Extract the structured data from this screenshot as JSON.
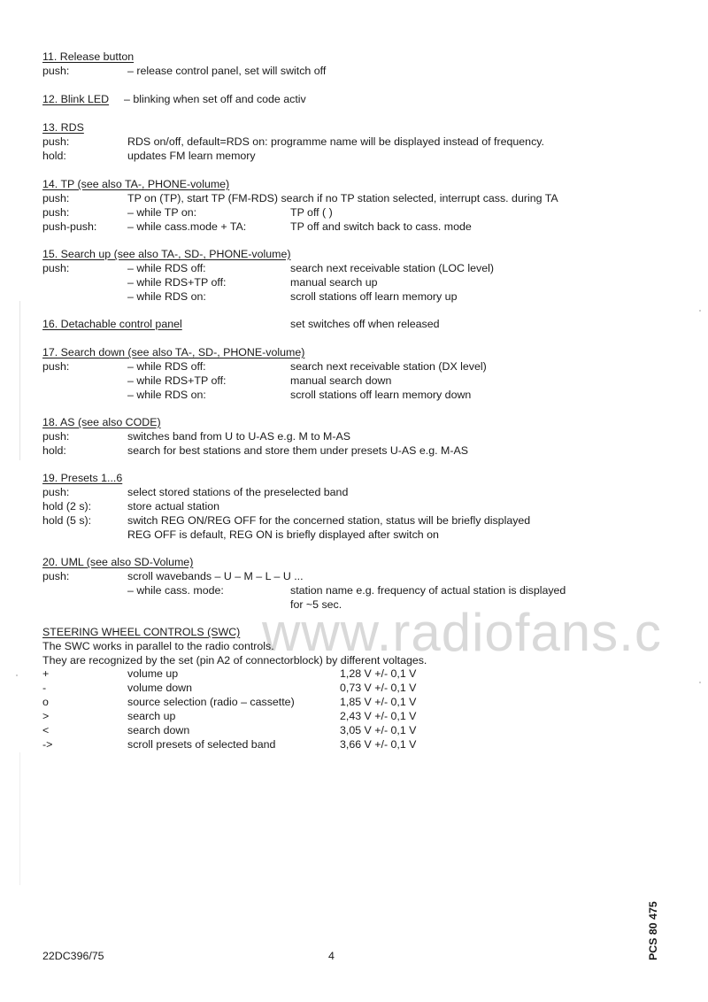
{
  "sections": [
    {
      "title": "11. Release button",
      "rows": [
        {
          "action": "push:",
          "desc": "– release control panel, set will switch off"
        }
      ]
    },
    {
      "title": "12. Blink LED",
      "inline": "– blinking when set off and code activ"
    },
    {
      "title": "13. RDS",
      "rows": [
        {
          "action": "push:",
          "desc": "RDS on/off, default=RDS on: programme name will be displayed instead of frequency."
        },
        {
          "action": "hold:",
          "desc": "updates FM learn memory"
        }
      ]
    },
    {
      "title": "14. TP (see also TA-, PHONE-volume)",
      "rows": [
        {
          "action": "push:",
          "desc": "TP on (TP), start TP (FM-RDS) search if no TP station selected, interrupt cass. during TA"
        },
        {
          "action": "push:",
          "cond": "– while TP on:",
          "result": "TP off (  )"
        },
        {
          "action": "push-push:",
          "cond": "– while cass.mode + TA:",
          "result": "TP off and switch back to cass. mode"
        }
      ]
    },
    {
      "title": "15. Search up (see also TA-, SD-, PHONE-volume)",
      "rows": [
        {
          "action": "push:",
          "cond": "– while RDS off:",
          "result": "search next receivable station (LOC level)"
        },
        {
          "action": "",
          "cond": "– while RDS+TP off:",
          "result": "manual search up"
        },
        {
          "action": "",
          "cond": "– while RDS on:",
          "result": "scroll stations off learn memory up"
        }
      ]
    },
    {
      "title": "16. Detachable control panel",
      "inline": "set switches off when released"
    },
    {
      "title": "17. Search down (see also TA-, SD-, PHONE-volume)",
      "rows": [
        {
          "action": "push:",
          "cond": "– while RDS off:",
          "result": "search next receivable station (DX level)"
        },
        {
          "action": "",
          "cond": "– while RDS+TP off:",
          "result": "manual search down"
        },
        {
          "action": "",
          "cond": "– while RDS on:",
          "result": "scroll stations off learn memory down"
        }
      ]
    },
    {
      "title": "18. AS (see also CODE)",
      "rows": [
        {
          "action": "push:",
          "desc": "switches band from U to U-AS e.g. M to M-AS"
        },
        {
          "action": "hold:",
          "desc": "search for best stations and store them under presets U-AS e.g. M-AS"
        }
      ]
    },
    {
      "title": "19. Presets 1...6",
      "rows": [
        {
          "action": "push:",
          "desc": "select stored stations of the preselected band"
        },
        {
          "action": "hold (2 s):",
          "desc": "store actual station"
        },
        {
          "action": "hold (5 s):",
          "desc": "switch REG ON/REG OFF for the concerned station, status will be briefly displayed"
        },
        {
          "action": "",
          "desc": "REG OFF is default, REG ON is briefly displayed after switch on"
        }
      ]
    },
    {
      "title": "20. UML (see also SD-Volume)",
      "rows": [
        {
          "action": "push:",
          "desc": "scroll wavebands – U – M – L – U ..."
        },
        {
          "action": "",
          "cond": "– while cass. mode:",
          "result": "station name e.g. frequency of actual station is displayed"
        },
        {
          "action": "",
          "cond": "",
          "result": "for ~5 sec."
        }
      ]
    }
  ],
  "swc": {
    "title": "STEERING WHEEL CONTROLS (SWC)",
    "intro1": "The SWC works in parallel to the radio controls.",
    "intro2": "They are recognized by the set (pin A2 of connectorblock) by different voltages.",
    "rows": [
      {
        "key": "+",
        "function": "volume up",
        "voltage": "1,28 V +/- 0,1 V"
      },
      {
        "key": "-",
        "function": "volume down",
        "voltage": "0,73 V +/- 0,1 V"
      },
      {
        "key": "o",
        "function": "source selection (radio – cassette)",
        "voltage": "1,85 V +/- 0,1 V"
      },
      {
        "key": ">",
        "function": "search up",
        "voltage": "2,43 V +/- 0,1 V"
      },
      {
        "key": "<",
        "function": "search down",
        "voltage": "3,05 V +/- 0,1 V"
      },
      {
        "key": "->",
        "function": "scroll presets of selected band",
        "voltage": "3,66 V +/- 0,1 V"
      }
    ]
  },
  "watermark": "www.radiofans.c",
  "footer": {
    "model": "22DC396/75",
    "page": "4",
    "doc_code": "PCS 80 475"
  }
}
